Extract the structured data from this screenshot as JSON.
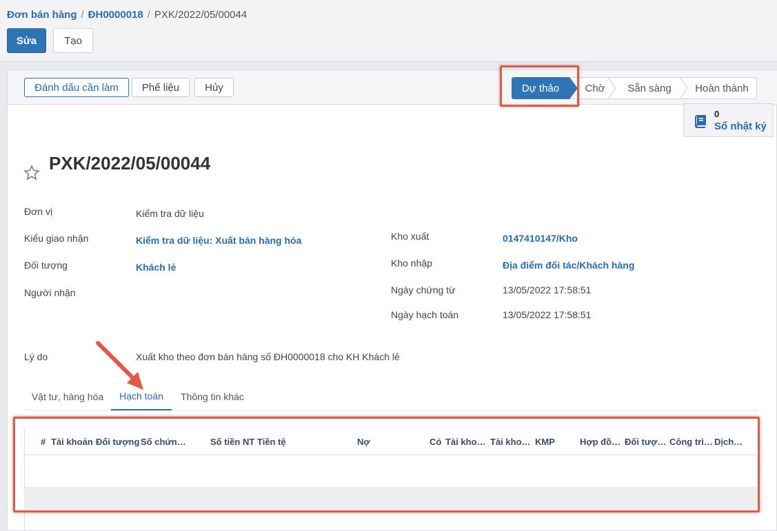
{
  "breadcrumb": {
    "root": "Đơn bán hàng",
    "parent": "ĐH0000018",
    "current": "PXK/2022/05/00044"
  },
  "controls": {
    "edit_label": "Sửa",
    "create_label": "Tạo"
  },
  "statusbar": {
    "buttons": [
      "Đánh dấu cần làm",
      "Phế liệu",
      "Hủy"
    ],
    "stages": [
      "Dự thảo",
      "Chờ",
      "Sẵn sàng",
      "Hoàn thành"
    ],
    "active_stage": "Dự thảo"
  },
  "smart_button": {
    "count": "0",
    "label": "Sổ nhật ký",
    "icon": "book-icon"
  },
  "record": {
    "title": "PXK/2022/05/00044",
    "left_fields": [
      {
        "label": "Đơn vị",
        "value": "Kiểm tra dữ liệu"
      },
      {
        "label": "Kiểu giao nhận",
        "value": "Kiểm tra dữ liệu: Xuất bán hàng hóa"
      },
      {
        "label": "Đối tượng",
        "value": "Khách lẻ"
      },
      {
        "label": "Người nhận",
        "value": ""
      }
    ],
    "right_fields": [
      {
        "label": "Kho xuất",
        "value": "0147410147/Kho"
      },
      {
        "label": "Kho nhập",
        "value": "Địa điểm đối tác/Khách hàng"
      },
      {
        "label": "Ngày chứng từ",
        "value": "13/05/2022 17:58:51"
      },
      {
        "label": "Ngày hạch toán",
        "value": "13/05/2022 17:58:51"
      }
    ],
    "reason": {
      "label": "Lý do",
      "value": "Xuất kho theo đơn bán hàng số ĐH0000018 cho KH Khách lẻ"
    }
  },
  "tabs": [
    "Vật tư, hàng hóa",
    "Hạch toán",
    "Thông tin khác"
  ],
  "active_tab": "Hạch toán",
  "grid": {
    "columns": [
      "#",
      "Tài khoản",
      "Đối tượng",
      "Số chứn…",
      "Số tiền NT",
      "Tiền tệ",
      "Nợ",
      "Có",
      "Tài kho…",
      "Tài kho…",
      "KMP",
      "Hợp đồ…",
      "Đối tượ…",
      "Công trì…",
      "Dịch…"
    ]
  },
  "colors": {
    "primary": "#2f74b5",
    "link": "#2a6cae",
    "annotation": "#e05a45"
  }
}
